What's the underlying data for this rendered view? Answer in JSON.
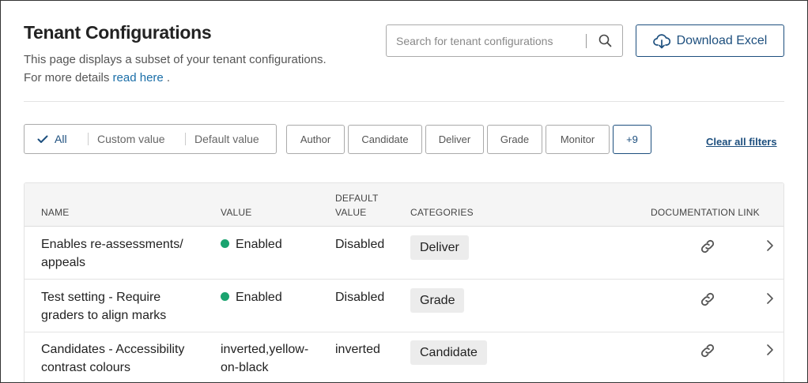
{
  "page": {
    "title": "Tenant Configurations",
    "description_line1": "This page displays a subset of your tenant configurations.",
    "description_line2_prefix": "For more details ",
    "read_here_link": "read here",
    "description_line2_suffix": " ."
  },
  "search": {
    "placeholder": "Search for tenant configurations",
    "value": "",
    "icon": "search-icon"
  },
  "download_button": {
    "label": "Download Excel",
    "icon": "cloud-download-icon"
  },
  "value_filter": {
    "options": [
      {
        "label": "All",
        "selected": true
      },
      {
        "label": "Custom value",
        "selected": false
      },
      {
        "label": "Default value",
        "selected": false
      }
    ]
  },
  "category_filters": [
    "Author",
    "Candidate",
    "Deliver",
    "Grade",
    "Monitor"
  ],
  "more_filters_label": "+9",
  "clear_filters_label": "Clear all filters",
  "table": {
    "headers": {
      "name": "NAME",
      "value": "VALUE",
      "default_value_line1": "DEFAULT",
      "default_value_line2": "VALUE",
      "categories": "CATEGORIES",
      "documentation_link": "DOCUMENTATION LINK"
    },
    "rows": [
      {
        "name_line1": "Enables re-assessments/",
        "name_line2": "appeals",
        "value_line1": "Enabled",
        "value_line2": "",
        "value_status": "enabled",
        "default_value": "Disabled",
        "category": "Deliver"
      },
      {
        "name_line1": "Test setting - Require",
        "name_line2": "graders to align marks",
        "value_line1": "Enabled",
        "value_line2": "",
        "value_status": "enabled",
        "default_value": "Disabled",
        "category": "Grade"
      },
      {
        "name_line1": "Candidates - Accessibility",
        "name_line2": "contrast colours",
        "value_line1": "inverted,yellow-",
        "value_line2": "on-black",
        "value_status": "custom",
        "default_value": "inverted",
        "category": "Candidate"
      }
    ]
  },
  "colors": {
    "accent": "#1d4f7e",
    "link": "#1a6ea8",
    "enabled_dot": "#1aa36f"
  }
}
